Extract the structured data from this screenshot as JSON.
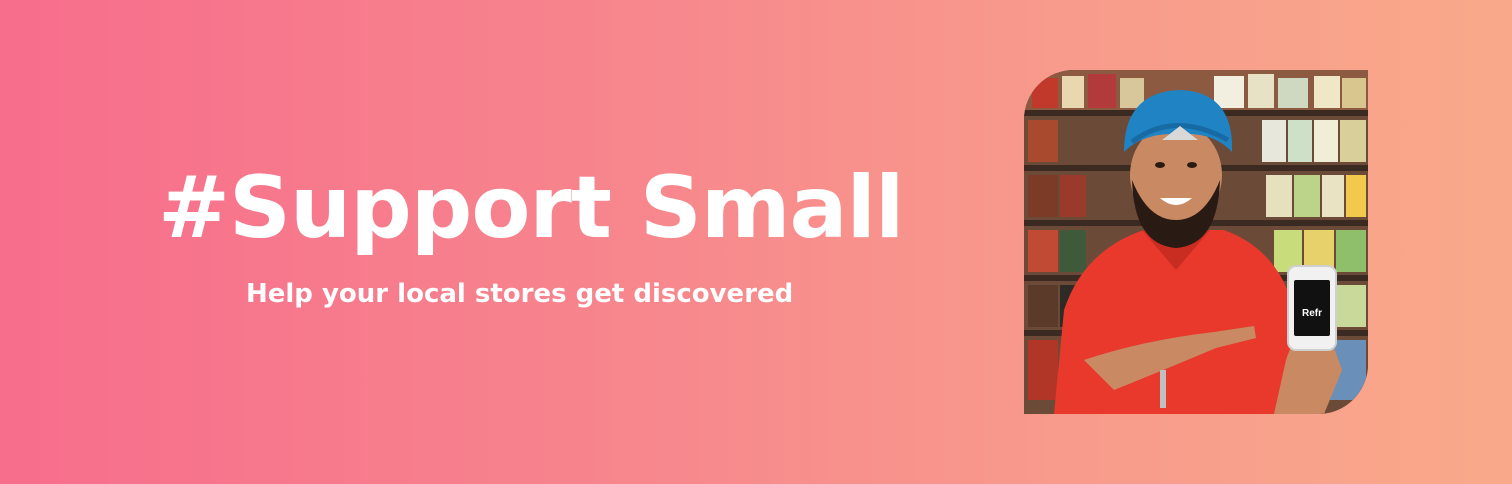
{
  "hero": {
    "headline": "#Support Small",
    "subline": "Help your local stores get discovered"
  },
  "photo": {
    "phone_screen_text": "Refr"
  },
  "colors": {
    "gradient_start": "#f76d8c",
    "gradient_end": "#f9a98a",
    "text": "#ffffff",
    "turban": "#1f83c4",
    "shirt": "#e8392c"
  }
}
